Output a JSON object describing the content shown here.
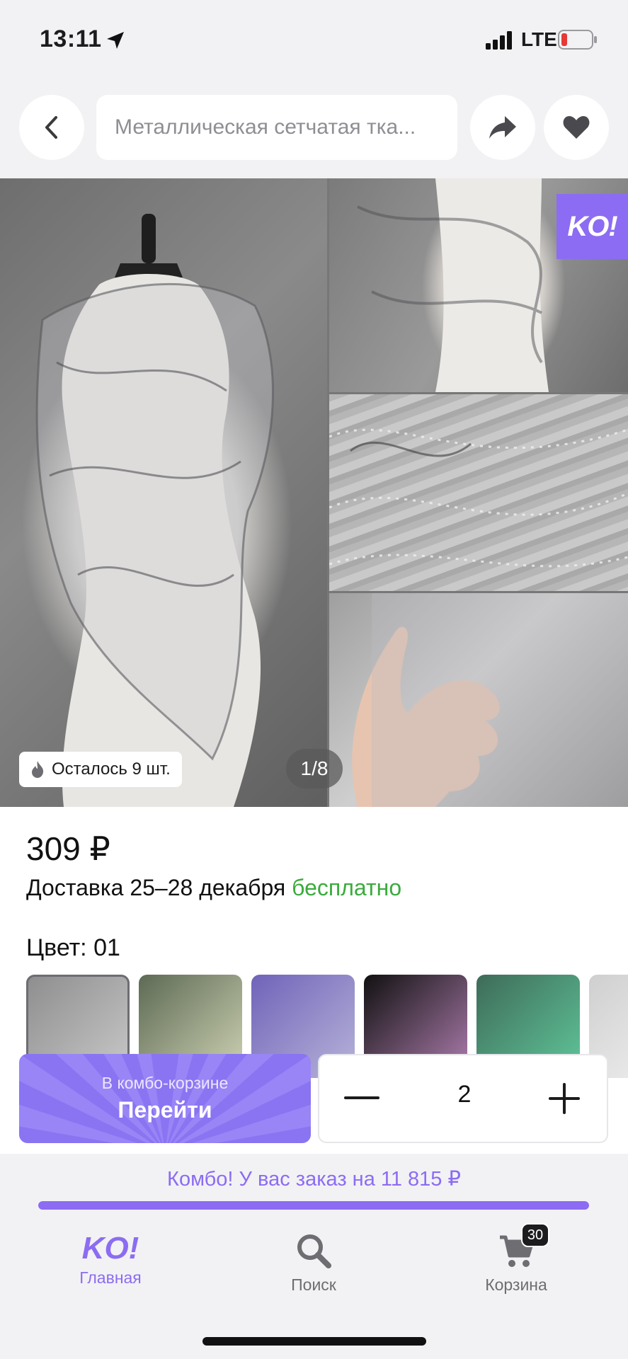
{
  "status_bar": {
    "time": "13:11",
    "network": "LTE"
  },
  "header": {
    "search_text": "Металлическая сетчатая тка..."
  },
  "gallery": {
    "sticker_text": "KO!",
    "stock_text": "Осталось 9 шт.",
    "counter": "1/8"
  },
  "product": {
    "price": "309 ₽",
    "delivery_prefix": "Доставка 25–28 декабря ",
    "delivery_free": "бесплатно",
    "color_label": "Цвет: 01"
  },
  "variants": [
    {
      "selected": true,
      "colors": [
        "#8d8d8d",
        "#c9c9c9"
      ]
    },
    {
      "selected": false,
      "colors": [
        "#5d6a54",
        "#cfd3b4"
      ]
    },
    {
      "selected": false,
      "colors": [
        "#6f63b9",
        "#b7b4d9"
      ]
    },
    {
      "selected": false,
      "colors": [
        "#111111",
        "#b07fb0"
      ]
    },
    {
      "selected": false,
      "colors": [
        "#3e6b58",
        "#60c79b"
      ]
    },
    {
      "selected": false,
      "colors": [
        "#cfcfcf",
        "#f3f3f3"
      ]
    }
  ],
  "combo": {
    "caption": "В комбо-корзине",
    "button_label": "Перейти",
    "quantity": "2",
    "notice": "Комбо! У вас заказ на 11 815 ₽",
    "progress": 1.0
  },
  "tabbar": {
    "home_logo": "KO!",
    "home_label": "Главная",
    "search_label": "Поиск",
    "cart_label": "Корзина",
    "cart_badge": "30"
  },
  "colors": {
    "accent": "#8c6cf2",
    "free_green": "#3bab3e"
  }
}
